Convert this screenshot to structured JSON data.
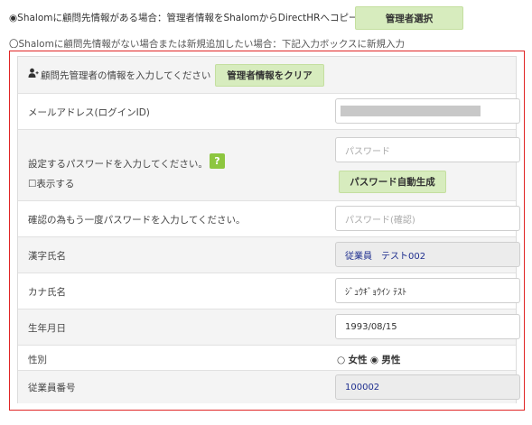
{
  "top": {
    "option1_text": "◉Shalomに顧問先情報がある場合：管理者情報をShalomからDirectHRへコピー",
    "select_admin_button": "管理者選択",
    "option2_text": "〇Shalomに顧問先情報がない場合または新規追加したい場合：下記入力ボックスに新規入力"
  },
  "form": {
    "header_label": "顧問先管理者の情報を入力してください",
    "header_icon": "person-icon",
    "clear_button": "管理者情報をクリア",
    "email": {
      "label": "メールアドレス(ログインID)",
      "value": ""
    },
    "password": {
      "label": "設定するパスワードを入力してください。",
      "help": "?",
      "show_label": "☐表示する",
      "placeholder": "パスワード",
      "generate_button": "パスワード自動生成"
    },
    "password_confirm": {
      "label": "確認の為もう一度パスワードを入力してください。",
      "placeholder": "パスワード(確認)"
    },
    "kanji_name": {
      "label": "漢字氏名",
      "value": "従業員　テスト002"
    },
    "kana_name": {
      "label": "カナ氏名",
      "value": "ｼﾞｭｳｷﾞｮｳｲﾝ ﾃｽﾄ"
    },
    "birthdate": {
      "label": "生年月日",
      "value": "1993/08/15"
    },
    "gender": {
      "label": "性別",
      "female_mark": "○",
      "female": "女性",
      "male_mark": "◉",
      "male": "男性"
    },
    "employee_no": {
      "label": "従業員番号",
      "value": "100002"
    }
  },
  "colors": {
    "accent_green": "#d7ecbe",
    "highlight_border": "#e02525",
    "readonly_text": "#1f2f8f"
  }
}
